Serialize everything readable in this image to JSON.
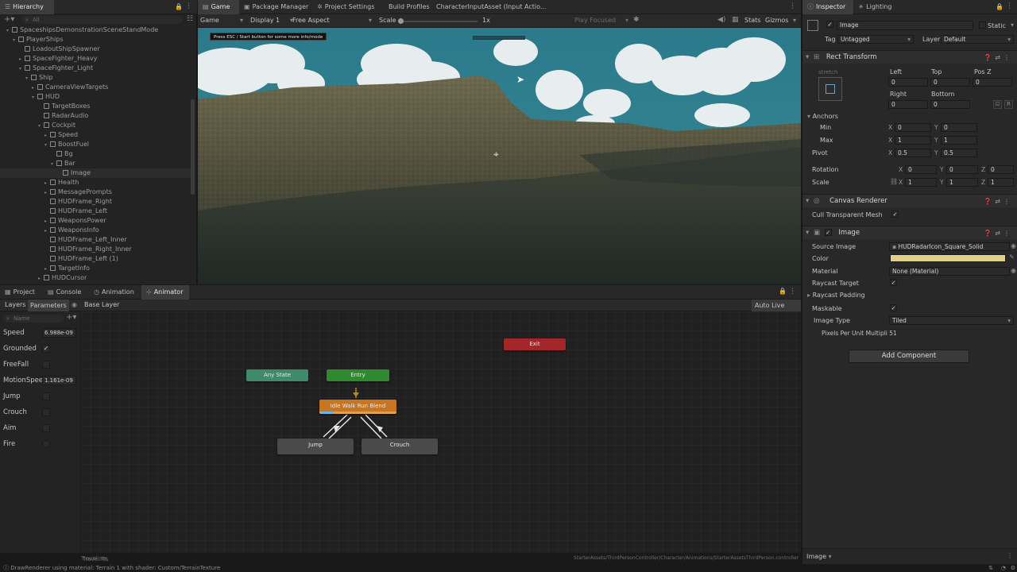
{
  "hierarchy": {
    "tab": "Hierarchy",
    "search_placeholder": "All",
    "rows": [
      {
        "label": "SpaceshipsDemonstrationSceneStandMode",
        "indent": 1,
        "arrow": "▾"
      },
      {
        "label": "PlayerShips",
        "indent": 2,
        "arrow": "▾"
      },
      {
        "label": "LoadoutShipSpawner",
        "indent": 3,
        "arrow": ""
      },
      {
        "label": "SpaceFighter_Heavy",
        "indent": 3,
        "arrow": "▸"
      },
      {
        "label": "SpaceFighter_Light",
        "indent": 3,
        "arrow": "▾"
      },
      {
        "label": "Ship",
        "indent": 4,
        "arrow": "▾"
      },
      {
        "label": "CameraViewTargets",
        "indent": 5,
        "arrow": "▸"
      },
      {
        "label": "HUD",
        "indent": 5,
        "arrow": "▾"
      },
      {
        "label": "TargetBoxes",
        "indent": 6,
        "arrow": ""
      },
      {
        "label": "RadarAudio",
        "indent": 6,
        "arrow": ""
      },
      {
        "label": "Cockpit",
        "indent": 6,
        "arrow": "▾"
      },
      {
        "label": "Speed",
        "indent": 7,
        "arrow": "▸"
      },
      {
        "label": "BoostFuel",
        "indent": 7,
        "arrow": "▾"
      },
      {
        "label": "Bg",
        "indent": 8,
        "arrow": ""
      },
      {
        "label": "Bar",
        "indent": 8,
        "arrow": "▾"
      },
      {
        "label": "Image",
        "indent": 9,
        "arrow": "",
        "selected": true
      },
      {
        "label": "Health",
        "indent": 7,
        "arrow": "▸"
      },
      {
        "label": "MessagePrompts",
        "indent": 7,
        "arrow": "▸"
      },
      {
        "label": "HUDFrame_Right",
        "indent": 7,
        "arrow": ""
      },
      {
        "label": "HUDFrame_Left",
        "indent": 7,
        "arrow": ""
      },
      {
        "label": "WeaponsPower",
        "indent": 7,
        "arrow": "▸"
      },
      {
        "label": "WeaponsInfo",
        "indent": 7,
        "arrow": "▸"
      },
      {
        "label": "HUDFrame_Left_Inner",
        "indent": 7,
        "arrow": ""
      },
      {
        "label": "HUDFrame_Right_Inner",
        "indent": 7,
        "arrow": ""
      },
      {
        "label": "HUDFrame_Left (1)",
        "indent": 7,
        "arrow": ""
      },
      {
        "label": "TargetInfo",
        "indent": 7,
        "arrow": "▸"
      },
      {
        "label": "HUDCursor",
        "indent": 6,
        "arrow": "▸"
      }
    ]
  },
  "top_tabs": [
    {
      "label": "Game",
      "icon": "▤",
      "active": true
    },
    {
      "label": "Package Manager",
      "icon": "▣"
    },
    {
      "label": "Project Settings",
      "icon": "✲"
    },
    {
      "label": "Build Profiles",
      "icon": ""
    },
    {
      "label": "CharacterInputAsset (Input Actio...",
      "icon": ""
    }
  ],
  "game_toolbar": {
    "mode": "Game",
    "display": "Display 1",
    "aspect": "Free Aspect",
    "scale_label": "Scale",
    "scale_value": "1x",
    "play_focused": "Play Focused",
    "stats": "Stats",
    "gizmos": "Gizmos"
  },
  "game_overlay": {
    "hint": "Press ESC / Start button for some more info/mode"
  },
  "bottom_tabs": [
    {
      "label": "Project",
      "icon": "▦"
    },
    {
      "label": "Console",
      "icon": "▤"
    },
    {
      "label": "Animation",
      "icon": "◷"
    },
    {
      "label": "Animator",
      "icon": "⊹",
      "active": true
    }
  ],
  "animator": {
    "layers_tab": "Layers",
    "parameters_tab": "Parameters",
    "breadcrumb": "Base Layer",
    "auto_live_link": "Auto Live Link",
    "search_placeholder": "Name",
    "parameters": [
      {
        "name": "Speed",
        "type": "float",
        "value": "6.988e-09"
      },
      {
        "name": "Grounded",
        "type": "bool",
        "checked": true
      },
      {
        "name": "FreeFall",
        "type": "bool",
        "checked": false
      },
      {
        "name": "MotionSpeed",
        "type": "float",
        "value": "1.161e-09"
      },
      {
        "name": "Jump",
        "type": "bool",
        "checked": false
      },
      {
        "name": "Crouch",
        "type": "bool",
        "checked": false
      },
      {
        "name": "Aim",
        "type": "bool",
        "checked": false
      },
      {
        "name": "Fire",
        "type": "trigger",
        "checked": false
      }
    ],
    "nodes": {
      "any_state": "Any State",
      "entry": "Entry",
      "exit": "Exit",
      "blend": "Idle Walk Run Blend",
      "jump": "Jump",
      "crouch": "Crouch"
    },
    "footer_left": "Travel.rts",
    "footer_right": "StarterAssets/ThirdPersonController/Character/Animations/StarterAssetsThirdPerson.controller"
  },
  "inspector": {
    "tabs": [
      {
        "label": "Inspector",
        "icon": "ⓘ",
        "active": true
      },
      {
        "label": "Lighting",
        "icon": "☀"
      }
    ],
    "object_name": "Image",
    "static_label": "Static",
    "tag_label": "Tag",
    "tag_value": "Untagged",
    "layer_label": "Layer",
    "layer_value": "Default",
    "rect_transform": {
      "title": "Rect Transform",
      "stretch": "stretch",
      "left_label": "Left",
      "top_label": "Top",
      "posz_label": "Pos Z",
      "left": "0",
      "top": "0",
      "posz": "0",
      "right_label": "Right",
      "bottom_label": "Bottom",
      "right": "0",
      "bottom": "0",
      "anchors": "Anchors",
      "min": "Min",
      "max": "Max",
      "min_x": "0",
      "min_y": "0",
      "max_x": "1",
      "max_y": "1",
      "pivot": "Pivot",
      "pivot_x": "0.5",
      "pivot_y": "0.5",
      "rotation": "Rotation",
      "rot_x": "0",
      "rot_y": "0",
      "rot_z": "0",
      "scale": "Scale",
      "scale_x": "1",
      "scale_y": "1",
      "scale_z": "1"
    },
    "canvas_renderer": {
      "title": "Canvas Renderer",
      "cull_label": "Cull Transparent Mesh"
    },
    "image": {
      "title": "Image",
      "source_label": "Source Image",
      "source_value": "HUDRadarIcon_Square_Solid",
      "color_label": "Color",
      "color_value": "#e0d08a",
      "material_label": "Material",
      "material_value": "None (Material)",
      "raycast_target": "Raycast Target",
      "raycast_padding": "Raycast Padding",
      "maskable": "Maskable",
      "image_type_label": "Image Type",
      "image_type_value": "Tiled",
      "ppu_label": "Pixels Per Unit Multipli",
      "ppu_value": "51"
    },
    "add_component": "Add Component",
    "footer_label": "Image"
  },
  "status_bar": {
    "message": "DrawRenderer using material: Terrain 1 with shader: Custom/TerrainTexture"
  },
  "colors": {
    "entry_node": "#2f8a2f",
    "any_state_node": "#3f8a6a",
    "exit_node": "#a3262a",
    "blend_node": "#c77521",
    "state_node": "#4a4a4a",
    "sky": "#2f7a8a"
  }
}
